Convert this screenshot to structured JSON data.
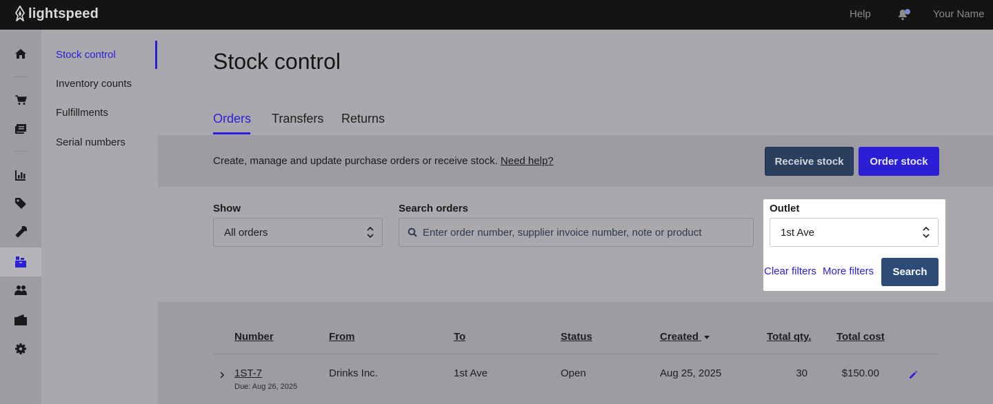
{
  "topbar": {
    "brand": "lightspeed",
    "help": "Help",
    "user_name": "Your Name"
  },
  "rail": {
    "icons": [
      "home-icon",
      "cart-icon",
      "register-icon",
      "reports-icon",
      "tag-icon",
      "wrench-icon",
      "inventory-icon",
      "customers-icon",
      "wallet-icon",
      "settings-icon"
    ],
    "active": "inventory-icon"
  },
  "subnav": {
    "items": [
      {
        "label": "Stock control"
      },
      {
        "label": "Inventory counts"
      },
      {
        "label": "Fulfillments"
      },
      {
        "label": "Serial numbers"
      }
    ]
  },
  "page": {
    "title": "Stock control",
    "tabs": [
      {
        "label": "Orders"
      },
      {
        "label": "Transfers"
      },
      {
        "label": "Returns"
      }
    ],
    "info_text": "Create, manage and update purchase orders or receive stock.",
    "info_help": "Need help?",
    "receive_stock": "Receive stock",
    "order_stock": "Order stock"
  },
  "filters": {
    "show_label": "Show",
    "show_value": "All orders",
    "search_label": "Search orders",
    "search_placeholder": "Enter order number, supplier invoice number, note or product",
    "outlet_label": "Outlet",
    "outlet_value": "1st Ave",
    "clear_filters": "Clear filters",
    "more_filters": "More filters",
    "search_button": "Search"
  },
  "table": {
    "headers": {
      "number": "Number",
      "from": "From",
      "to": "To",
      "status": "Status",
      "created": "Created",
      "total_qty": "Total qty.",
      "total_cost": "Total cost"
    },
    "rows": [
      {
        "number": "1ST-7",
        "due": "Due: Aug 26, 2025",
        "from": "Drinks Inc.",
        "to": "1st Ave",
        "status": "Open",
        "created": "Aug 25, 2025",
        "total_qty": "30",
        "total_cost": "$150.00"
      }
    ]
  },
  "colors": {
    "accent": "#2a1fd6",
    "topbar": "#141414",
    "receive_button": "#2a3e5e",
    "search_button": "#2c4b77"
  }
}
